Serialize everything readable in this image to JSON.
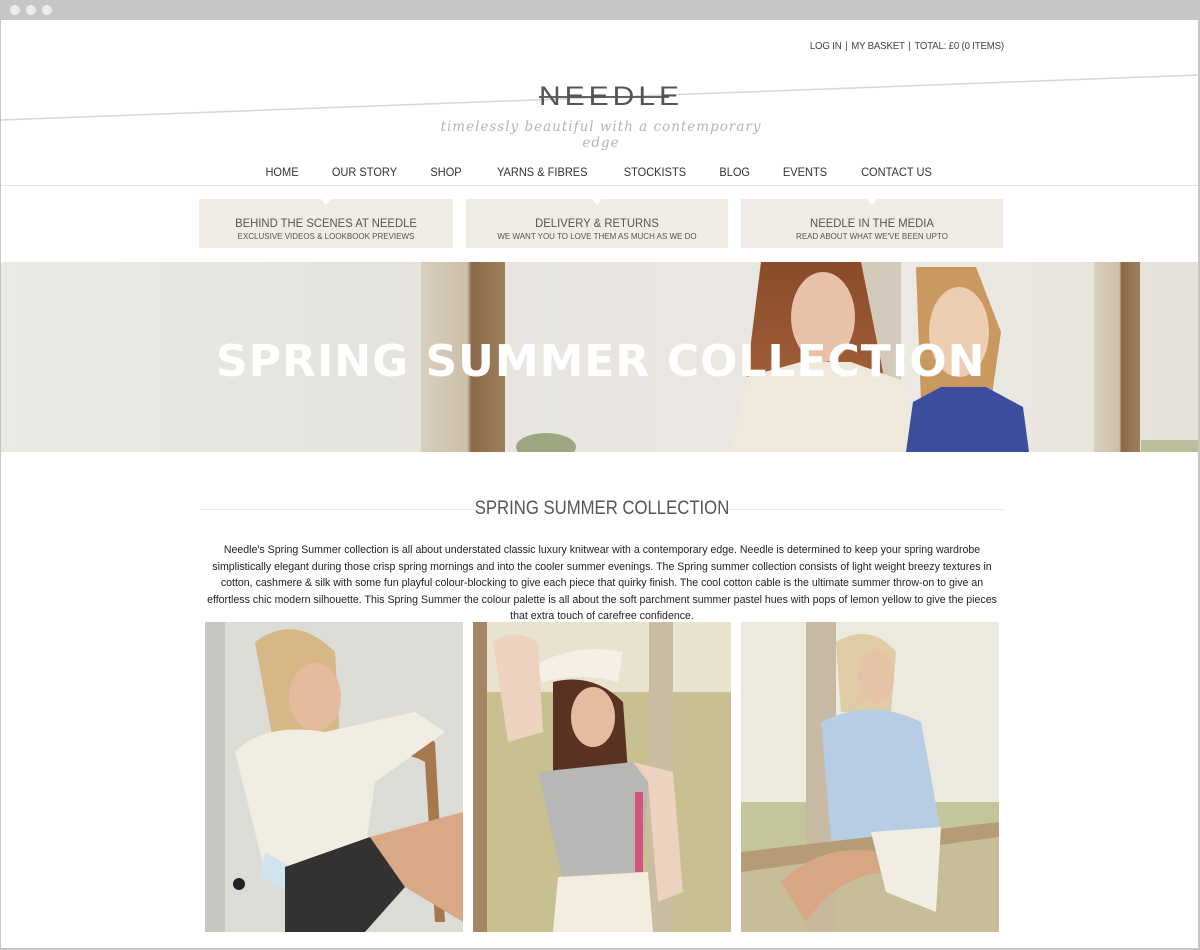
{
  "browser": {
    "controls": [
      "close",
      "minimize",
      "maximize"
    ]
  },
  "account_bar": {
    "login": "LOG IN",
    "basket": "MY BASKET",
    "separator": "|",
    "total": "TOTAL: £0 (0 ITEMS)"
  },
  "brand": {
    "logo": "NEEDLE",
    "tagline": "timelessly beautiful with a contemporary edge"
  },
  "nav": {
    "items": [
      "HOME",
      "OUR STORY",
      "SHOP",
      "YARNS & FIBRES",
      "STOCKISTS",
      "BLOG",
      "EVENTS",
      "CONTACT US"
    ]
  },
  "promos": [
    {
      "title": "BEHIND THE SCENES AT NEEDLE",
      "subtitle": "EXCLUSIVE VIDEOS & LOOKBOOK PREVIEWS"
    },
    {
      "title": "DELIVERY & RETURNS",
      "subtitle": "WE WANT YOU TO LOVE THEM AS MUCH AS WE DO"
    },
    {
      "title": "NEEDLE IN THE MEDIA",
      "subtitle": "READ ABOUT WHAT WE'VE BEEN UPTO"
    }
  ],
  "hero": {
    "title": "SPRING SUMMER COLLECTION",
    "image": "two models in knitwear on a wooden porch"
  },
  "collection": {
    "heading": "SPRING SUMMER COLLECTION",
    "description": "Needle's Spring Summer collection is all about understated classic luxury knitwear with a contemporary edge. Needle is determined to keep your spring wardrobe simplistically elegant during those crisp spring mornings and into the cooler summer evenings. The Spring summer collection consists of light weight breezy textures in cotton, cashmere & silk with some fun playful colour-blocking to give each piece that quirky finish. The cool cotton cable is the ultimate summer throw-on to give an effortless chic modern silhouette. This Spring Summer the colour palette is all about the soft parchment summer pastel hues with pops of lemon yellow to give the pieces that extra touch of carefree confidence.",
    "photos": [
      {
        "alt": "model in cream jumper seated on wooden chair"
      },
      {
        "alt": "model in grey and pink colour-block jumper with visor"
      },
      {
        "alt": "model in pale blue cable knit jumper on porch rail"
      }
    ]
  },
  "colors": {
    "promo_bg": "#f0ece5",
    "text": "#333333",
    "frame": "#c6c6c6"
  }
}
